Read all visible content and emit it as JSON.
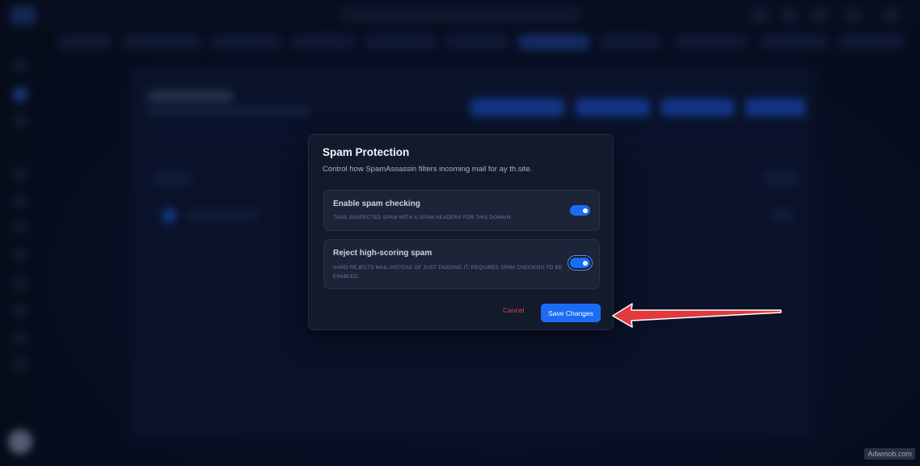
{
  "modal": {
    "title": "Spam Protection",
    "subtitle": "Control how SpamAssassin filters incoming mail for ay th.site.",
    "options": [
      {
        "title": "Enable spam checking",
        "description": "Tags suspected spam with X-Spam headers for this domain",
        "enabled": true
      },
      {
        "title": "Reject high-scoring spam",
        "description": "Hard-rejects mail instead of just tagging it. Requires spam checking to be enabled.",
        "enabled": true
      }
    ],
    "cancel_label": "Cancel",
    "save_label": "Save Changes"
  },
  "colors": {
    "accent": "#1a6cf5",
    "cancel": "#d14747",
    "modal_bg": "#131a2c",
    "arrow": "#e0393e"
  },
  "watermark": "Adwmob.com"
}
